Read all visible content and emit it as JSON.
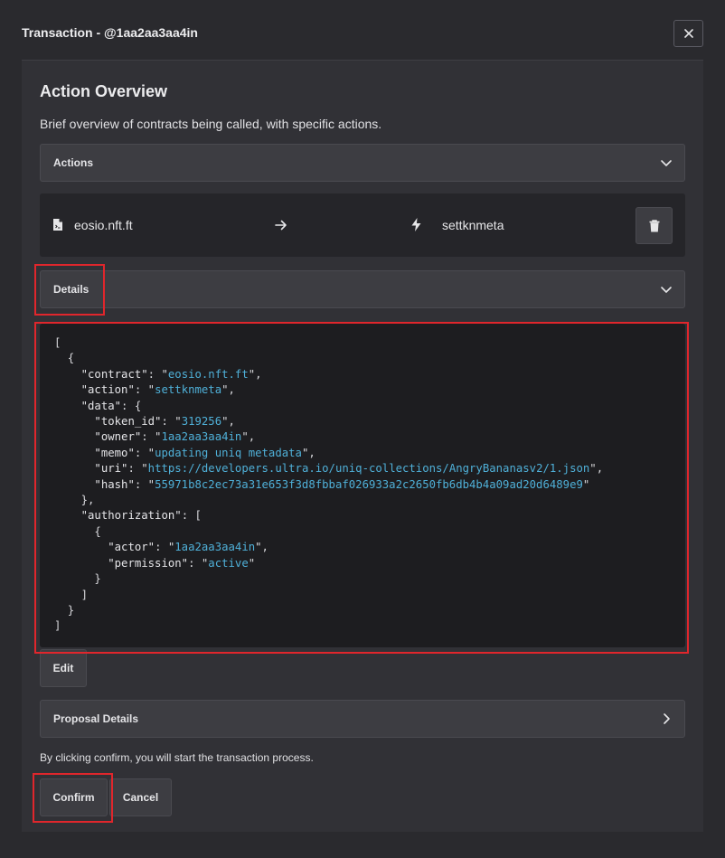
{
  "modal": {
    "title": "Transaction - @1aa2aa3aa4in",
    "close_icon": "close-icon"
  },
  "overview": {
    "title": "Action Overview",
    "subtitle": "Brief overview of contracts being called, with specific actions."
  },
  "actions_accordion": {
    "label": "Actions",
    "icon": "chevron-down-icon"
  },
  "action_row": {
    "contract": "eosio.nft.ft",
    "contract_icon": "file-icon",
    "arrow_icon": "arrow-right-icon",
    "action": "settknmeta",
    "action_icon": "bolt-icon",
    "delete_icon": "trash-icon"
  },
  "details_accordion": {
    "label": "Details",
    "icon": "chevron-down-icon"
  },
  "details_json": {
    "contract": "eosio.nft.ft",
    "action": "settknmeta",
    "token_id": "319256",
    "owner": "1aa2aa3aa4in",
    "memo": "updating uniq metadata",
    "uri": "https://developers.ultra.io/uniq-collections/AngryBananasv2/1.json",
    "hash": "55971b8c2ec73a31e653f3d8fbbaf026933a2c2650fb6db4b4a09ad20d6489e9",
    "actor": "1aa2aa3aa4in",
    "permission": "active"
  },
  "edit_button": "Edit",
  "proposal_accordion": {
    "label": "Proposal Details",
    "icon": "chevron-right-icon"
  },
  "confirm_note": "By clicking confirm, you will start the transaction process.",
  "buttons": {
    "confirm": "Confirm",
    "cancel": "Cancel"
  },
  "colors": {
    "background": "#2a2a2e",
    "panel": "#313136",
    "code_background": "#1d1d20",
    "string": "#4fb0d8",
    "highlight": "#e0262c"
  }
}
